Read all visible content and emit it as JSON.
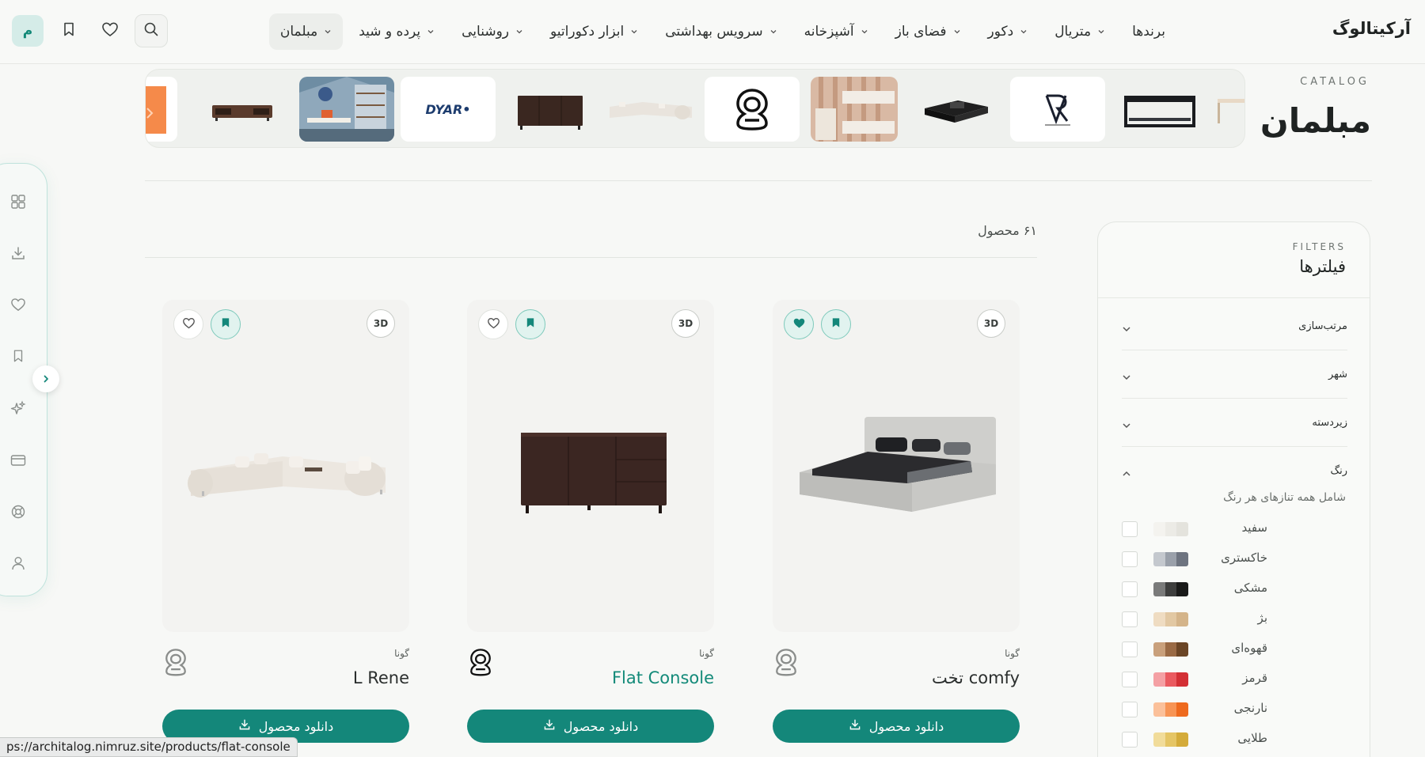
{
  "site": {
    "logo": "آرکیتالوگ"
  },
  "nav": {
    "items": [
      {
        "label": "مبلمان",
        "active": true,
        "dropdown": true
      },
      {
        "label": "پرده و شید",
        "dropdown": true
      },
      {
        "label": "روشنایی",
        "dropdown": true
      },
      {
        "label": "ابزار دکوراتیو",
        "dropdown": true
      },
      {
        "label": "سرویس بهداشتی",
        "dropdown": true
      },
      {
        "label": "آشپزخانه",
        "dropdown": true
      },
      {
        "label": "فضای باز",
        "dropdown": true
      },
      {
        "label": "دکور",
        "dropdown": true
      },
      {
        "label": "متریال",
        "dropdown": true
      },
      {
        "label": "برندها",
        "dropdown": false
      }
    ],
    "avatar_letter": "م",
    "icons": [
      "search-icon",
      "heart-icon",
      "bookmark-icon"
    ]
  },
  "catalog": {
    "eyebrow": "CATALOG",
    "title": "مبلمان",
    "strip_logos": {
      "dyar": "DYAR•"
    }
  },
  "rail": {
    "icons": [
      "grid-icon",
      "download-icon",
      "heart-icon",
      "bookmark-icon",
      "sparkle-icon",
      "card-icon",
      "support-icon",
      "user-icon"
    ]
  },
  "results": {
    "count_label": "۶۱ محصول"
  },
  "products": [
    {
      "brand": "گونا",
      "name": "L Rene",
      "badge": "3D",
      "download_label": "دانلود محصول",
      "liked": false,
      "bookmarked": true,
      "name_is_link": false
    },
    {
      "brand": "گونا",
      "name": "Flat Console",
      "badge": "3D",
      "download_label": "دانلود محصول",
      "liked": false,
      "bookmarked": true,
      "name_is_link": true
    },
    {
      "brand": "گونا",
      "name": "تخت comfy",
      "badge": "3D",
      "download_label": "دانلود محصول",
      "liked": true,
      "bookmarked": true,
      "name_is_link": false
    }
  ],
  "filters": {
    "eyebrow": "FILTERS",
    "title": "فیلترها",
    "sections": [
      {
        "label": "مرتب‌سازی",
        "expanded": false
      },
      {
        "label": "شهر",
        "expanded": false
      },
      {
        "label": "زیردسته",
        "expanded": false
      },
      {
        "label": "رنگ",
        "expanded": true
      }
    ],
    "color_hint": "شامل همه تنازهای هر رنگ",
    "colors": [
      {
        "name": "سفید",
        "swatch": [
          "#f4f3ef",
          "#ecebe6",
          "#e4e3dd"
        ]
      },
      {
        "name": "خاکستری",
        "swatch": [
          "#c4c8ce",
          "#9aa0aa",
          "#6e7480"
        ]
      },
      {
        "name": "مشکی",
        "swatch": [
          "#7a7a7a",
          "#3e3e3e",
          "#1a1a1a"
        ]
      },
      {
        "name": "بژ",
        "swatch": [
          "#efdcc2",
          "#e2c8a3",
          "#d4b48a"
        ]
      },
      {
        "name": "قهوه‌ای",
        "swatch": [
          "#c9a07c",
          "#9a6a45",
          "#6b4526"
        ]
      },
      {
        "name": "قرمز",
        "swatch": [
          "#f4a0a4",
          "#ea5a60",
          "#d32f35"
        ]
      },
      {
        "name": "نارنجی",
        "swatch": [
          "#fbc09a",
          "#f79455",
          "#ee6a1f"
        ]
      },
      {
        "name": "طلایی",
        "swatch": [
          "#f1dc9a",
          "#e5c565",
          "#d4ab3a"
        ]
      }
    ]
  },
  "status_bar": {
    "url": "ps://architalog.nimruz.site/products/flat-console"
  },
  "colors": {
    "accent": "#14877a",
    "accent_light": "#e1f3ef",
    "background": "#f7f8f6"
  }
}
